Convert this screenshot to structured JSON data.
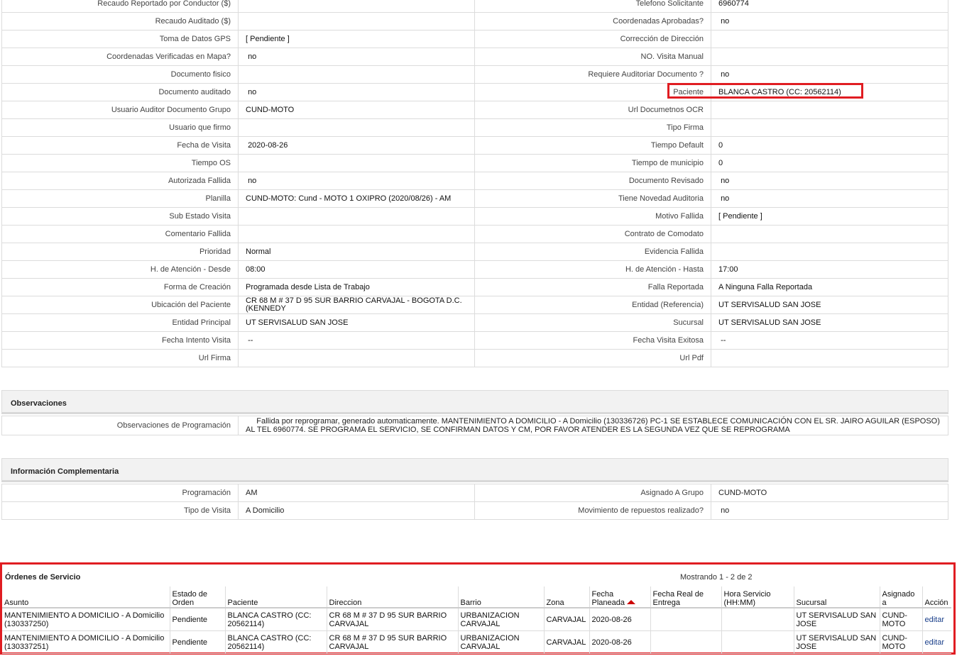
{
  "details": [
    {
      "l1": "Recaudo Reportado por Conductor ($)",
      "v1": "",
      "l2": "Telefono Solicitante",
      "v2": "6960774"
    },
    {
      "l1": "Recaudo Auditado ($)",
      "v1": "",
      "l2": "Coordenadas Aprobadas?",
      "v2": " no"
    },
    {
      "l1": "Toma de Datos GPS",
      "v1": "[ Pendiente ]",
      "l2": "Corrección de Dirección",
      "v2": ""
    },
    {
      "l1": "Coordenadas Verificadas en Mapa?",
      "v1": " no",
      "l2": "NO. Visita Manual",
      "v2": ""
    },
    {
      "l1": "Documento fisico",
      "v1": "",
      "l2": "Requiere Auditoriar Documento ?",
      "v2": " no"
    },
    {
      "l1": "Documento auditado",
      "v1": " no",
      "l2": "Paciente",
      "v2": "BLANCA CASTRO (CC: 20562114)"
    },
    {
      "l1": "Usuario Auditor Documento Grupo",
      "v1": "CUND-MOTO",
      "l2": "Url Documetnos OCR",
      "v2": ""
    },
    {
      "l1": "Usuario que firmo",
      "v1": "",
      "l2": "Tipo Firma",
      "v2": ""
    },
    {
      "l1": "Fecha de Visita",
      "v1": " 2020-08-26",
      "l2": "Tiempo Default",
      "v2": "0"
    },
    {
      "l1": "Tiempo OS",
      "v1": "",
      "l2": "Tiempo de municipio",
      "v2": "0"
    },
    {
      "l1": "Autorizada Fallida",
      "v1": " no",
      "l2": "Documento Revisado",
      "v2": " no"
    },
    {
      "l1": "Planilla",
      "v1": "CUND-MOTO: Cund - MOTO 1 OXIPRO (2020/08/26) - AM",
      "l2": "Tiene Novedad Auditoria",
      "v2": " no"
    },
    {
      "l1": "Sub Estado Visita",
      "v1": "",
      "l2": "Motivo Fallida",
      "v2": "[ Pendiente ]"
    },
    {
      "l1": "Comentario Fallida",
      "v1": "",
      "l2": "Contrato de Comodato",
      "v2": ""
    },
    {
      "l1": "Prioridad",
      "v1": "Normal",
      "l2": "Evidencia Fallida",
      "v2": ""
    },
    {
      "l1": "H. de Atención - Desde",
      "v1": "08:00",
      "l2": "H. de Atención - Hasta",
      "v2": "17:00"
    },
    {
      "l1": "Forma de Creación",
      "v1": "Programada desde Lista de Trabajo",
      "l2": "Falla Reportada",
      "v2": "A Ninguna Falla Reportada"
    },
    {
      "l1": "Ubicación del Paciente",
      "v1": "CR 68 M # 37 D 95 SUR BARRIO CARVAJAL - BOGOTA D.C. (KENNEDY",
      "l2": "Entidad (Referencia)",
      "v2": "UT SERVISALUD SAN JOSE"
    },
    {
      "l1": "Entidad Principal",
      "v1": "UT SERVISALUD SAN JOSE",
      "l2": "Sucursal",
      "v2": "UT SERVISALUD SAN JOSE"
    },
    {
      "l1": "Fecha Intento Visita",
      "v1": " --",
      "l2": "Fecha Visita Exitosa",
      "v2": " --"
    },
    {
      "l1": "Url Firma",
      "v1": "",
      "l2": "Url Pdf",
      "v2": ""
    }
  ],
  "observaciones": {
    "title": "Observaciones",
    "label": "Observaciones de Programación",
    "text": "     Fallida por reprogramar, generado automaticamente. MANTENIMIENTO A DOMICILIO - A Domicilio (130336726) PC-1 SE ESTABLECE COMUNICACIÓN CON EL SR. JAIRO AGUILAR (ESPOSO) AL TEL 6960774. SE PROGRAMA EL SERVICIO, SE CONFIRMAN DATOS Y CM, POR FAVOR ATENDER ES LA SEGUNDA VEZ QUE SE REPROGRAMA"
  },
  "info": {
    "title": "Información Complementaria",
    "rows": [
      {
        "l1": "Programación",
        "v1": "AM",
        "l2": "Asignado A Grupo",
        "v2": "CUND-MOTO"
      },
      {
        "l1": "Tipo de Visita",
        "v1": "A Domicilio",
        "l2": "Movimiento de repuestos realizado?",
        "v2": " no"
      }
    ]
  },
  "orders": {
    "title": "Órdenes de Servicio",
    "count": "Mostrando 1 - 2 de 2",
    "headers": [
      "Asunto",
      "Estado de Orden",
      "Paciente",
      "Direccion",
      "Barrio",
      "Zona",
      "Fecha Planeada",
      "Fecha Real de Entrega",
      "Hora Servicio (HH:MM)",
      "Sucursal",
      "Asignado a",
      "Acción"
    ],
    "rows": [
      {
        "asunto": "MANTENIMIENTO A DOMICILIO - A Domicilio (130337250)",
        "estado": "Pendiente",
        "paciente": "BLANCA CASTRO (CC: 20562114)",
        "direccion": "CR 68 M # 37 D 95 SUR BARRIO CARVAJAL",
        "barrio": "URBANIZACION CARVAJAL",
        "zona": "CARVAJAL",
        "fecha": "2020-08-26",
        "real": "",
        "hora": "",
        "sucursal": "UT SERVISALUD SAN JOSE",
        "asignado": "CUND-MOTO",
        "accion": "editar"
      },
      {
        "asunto": "MANTENIMIENTO A DOMICILIO - A Domicilio (130337251)",
        "estado": "Pendiente",
        "paciente": "BLANCA CASTRO (CC: 20562114)",
        "direccion": "CR 68 M # 37 D 95 SUR BARRIO CARVAJAL",
        "barrio": "URBANIZACION CARVAJAL",
        "zona": "CARVAJAL",
        "fecha": "2020-08-26",
        "real": "",
        "hora": "",
        "sucursal": "UT SERVISALUD SAN JOSE",
        "asignado": "CUND-MOTO",
        "accion": "editar"
      }
    ]
  },
  "colors": {
    "highlight": "#e01d22",
    "link": "#1a3f8a",
    "border": "#dcdcdc",
    "section_bg": "#f2f2f2"
  }
}
